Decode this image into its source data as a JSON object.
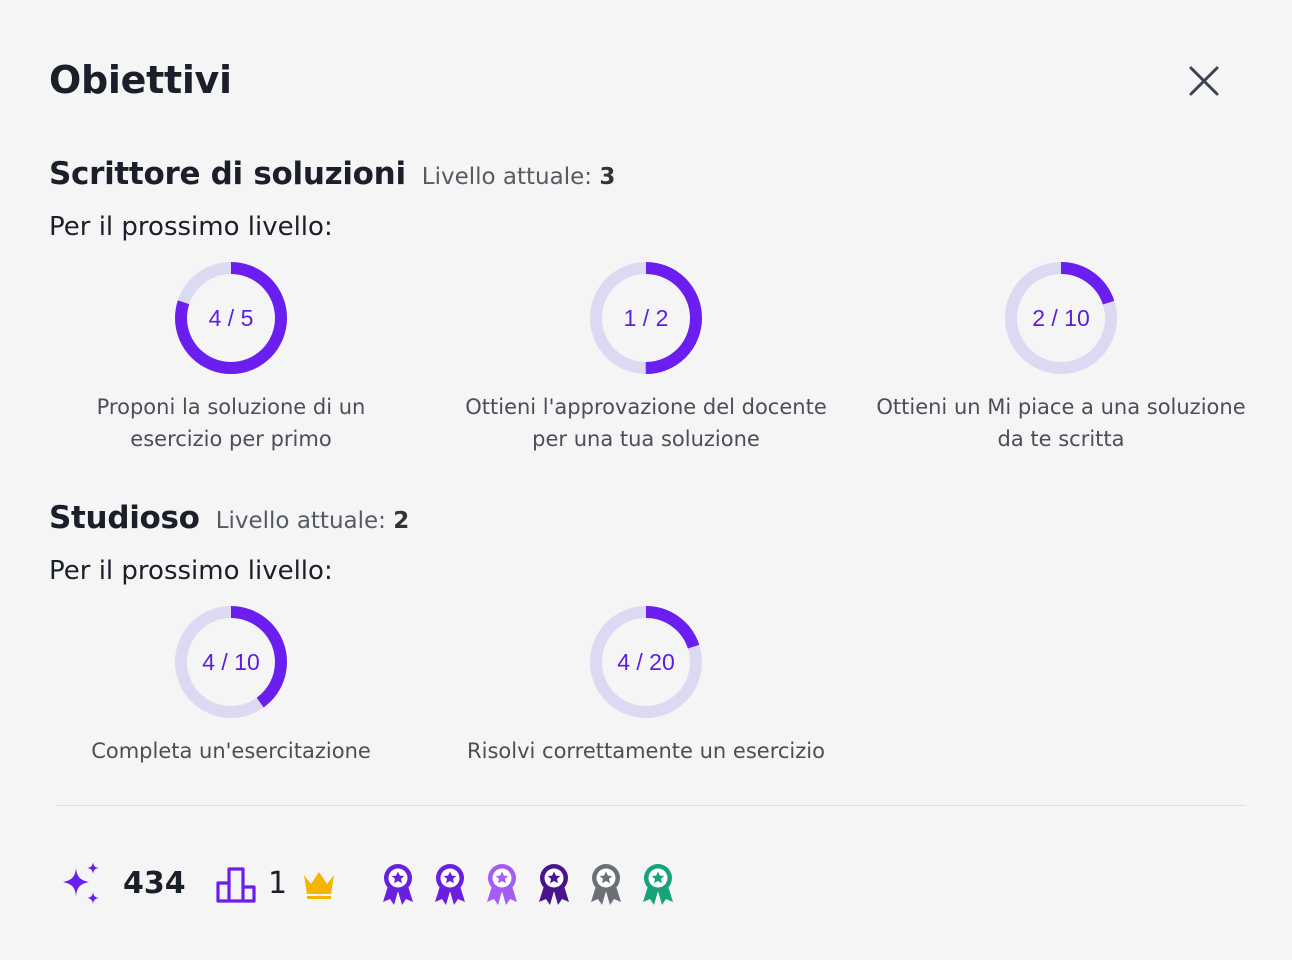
{
  "modal": {
    "title": "Obiettivi"
  },
  "sections": [
    {
      "name": "Scrittore di soluzioni",
      "level_prefix": "Livello attuale:",
      "level_value": "3",
      "next_label": "Per il prossimo livello:",
      "goals": [
        {
          "label": "4 / 5",
          "progress": 0.8,
          "desc": "Proponi la soluzione di un esercizio per primo"
        },
        {
          "label": "1 / 2",
          "progress": 0.5,
          "desc": "Ottieni l'approvazione del docente per una tua soluzione"
        },
        {
          "label": "2 / 10",
          "progress": 0.2,
          "desc": "Ottieni un Mi piace a una soluzione da te scritta"
        }
      ]
    },
    {
      "name": "Studioso",
      "level_prefix": "Livello attuale:",
      "level_value": "2",
      "next_label": "Per il prossimo livello:",
      "goals": [
        {
          "label": "4 / 10",
          "progress": 0.4,
          "desc": "Completa un'esercitazione"
        },
        {
          "label": "4 / 20",
          "progress": 0.2,
          "desc": "Risolvi correttamente un esercizio"
        }
      ]
    }
  ],
  "footer": {
    "points": "434",
    "rank": "1",
    "badge_colors": [
      "#6a1fe0",
      "#6a1fe0",
      "#a55cf2",
      "#4a148c",
      "#6b7078",
      "#17a37a"
    ]
  },
  "colors": {
    "ring_track": "#dcdaf2",
    "ring_fill": "#6a1ff0",
    "accent": "#6a1ff0",
    "crown": "#f5b400"
  },
  "icons": [
    "close-icon",
    "sparkles-icon",
    "leaderboard-icon",
    "crown-icon",
    "award-icon"
  ]
}
